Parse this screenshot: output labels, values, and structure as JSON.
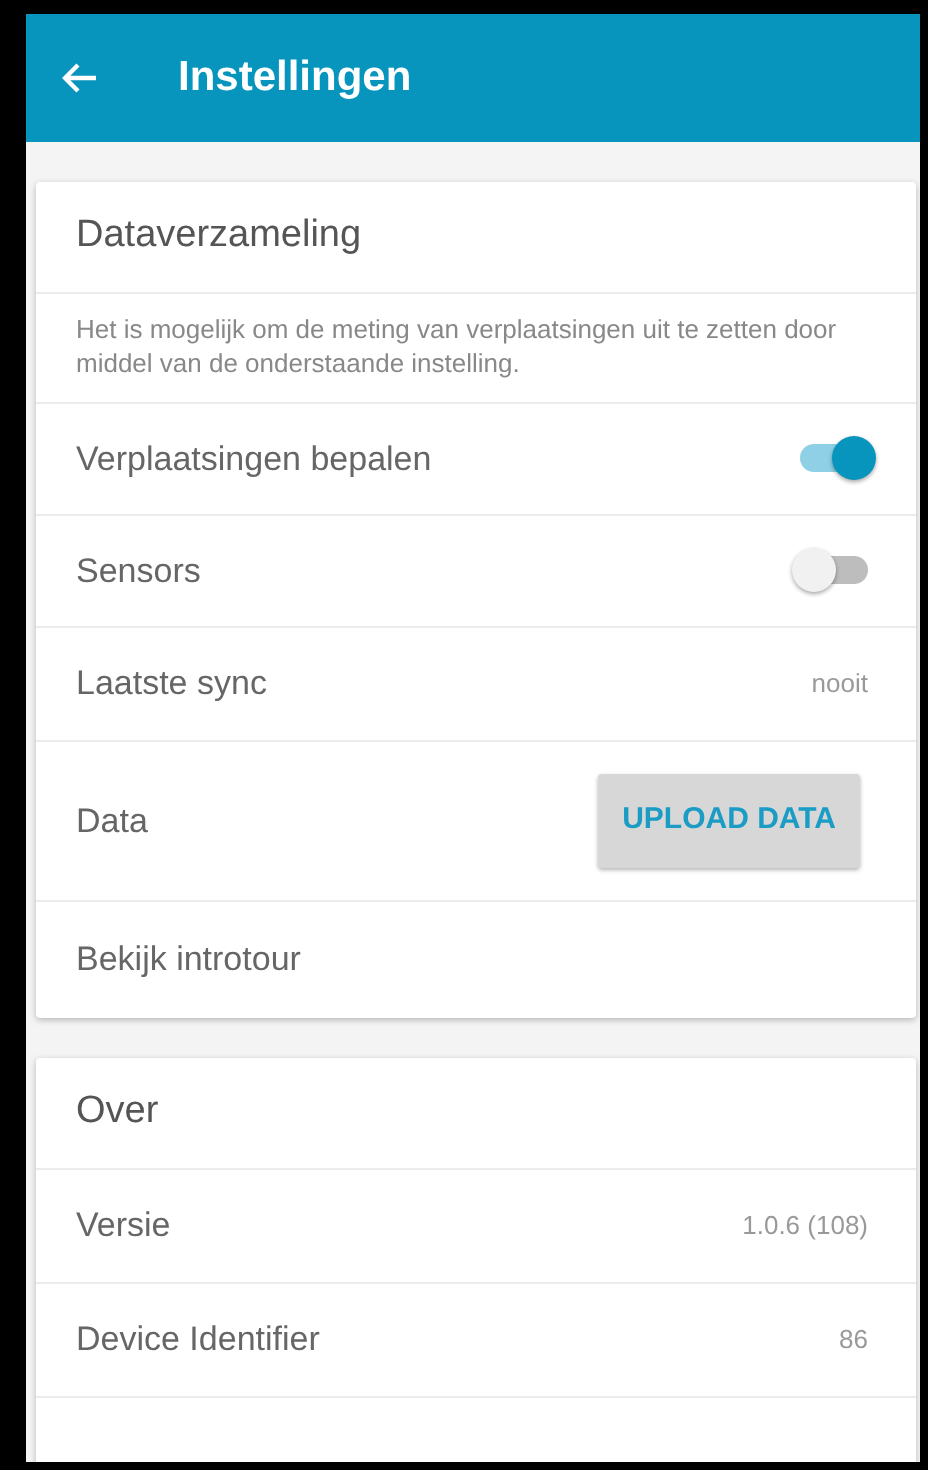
{
  "app_bar": {
    "title": "Instellingen"
  },
  "sections": [
    {
      "title": "Dataverzameling",
      "description": "Het is mogelijk om de meting van verplaatsingen uit te zetten door middel van de onderstaande instelling.",
      "rows": [
        {
          "kind": "toggle",
          "label": "Verplaatsingen bepalen",
          "on": true
        },
        {
          "kind": "toggle",
          "label": "Sensors",
          "on": false
        },
        {
          "kind": "value",
          "label": "Laatste sync",
          "value": "nooit"
        },
        {
          "kind": "button",
          "label": "Data",
          "button": "UPLOAD DATA"
        },
        {
          "kind": "link",
          "label": "Bekijk introtour"
        }
      ]
    },
    {
      "title": "Over",
      "rows": [
        {
          "kind": "value",
          "label": "Versie",
          "value": "1.0.6 (108)"
        },
        {
          "kind": "value",
          "label": "Device Identifier",
          "value": "86"
        }
      ]
    }
  ]
}
